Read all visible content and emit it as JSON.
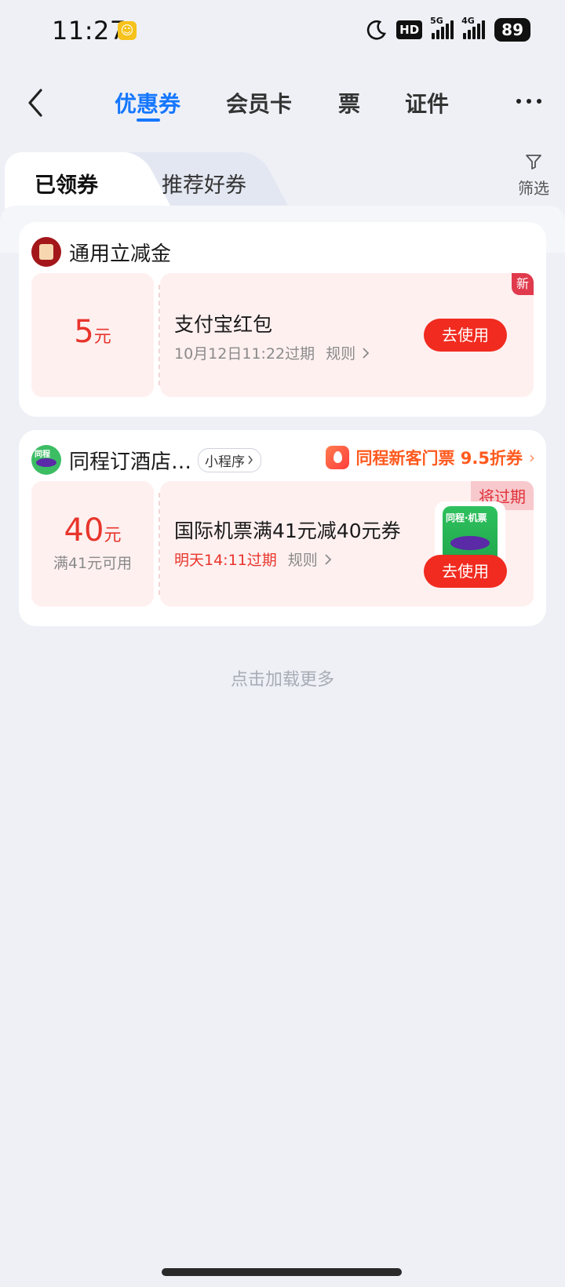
{
  "status_bar": {
    "time": "11:27",
    "hd_label": "HD",
    "network_1": "5G",
    "network_2": "4G",
    "battery": "89"
  },
  "header": {
    "tabs": [
      {
        "label": "优惠券",
        "active": true
      },
      {
        "label": "会员卡",
        "active": false
      },
      {
        "label": "票",
        "active": false
      },
      {
        "label": "证件",
        "active": false
      }
    ],
    "accent_color": "#1677ff"
  },
  "sub_tabs": {
    "active": "已领券",
    "inactive": "推荐好券",
    "filter_label": "筛选"
  },
  "cards": [
    {
      "title": "通用立减金",
      "coupon": {
        "amount": "5",
        "unit": "元",
        "name": "支付宝红包",
        "expire": "10月12日11:22过期",
        "rules": "规则",
        "badge": "新",
        "button": "去使用"
      }
    },
    {
      "title": "同程订酒店…",
      "tag": "小程序",
      "promo": "同程新客门票 9.5折券",
      "coupon": {
        "amount": "40",
        "unit": "元",
        "condition": "满41元可用",
        "name": "国际机票满41元减40元券",
        "expire": "明天14:11过期",
        "rules": "规则",
        "badge": "将过期",
        "thumb_label": "同程·机票",
        "button": "去使用"
      }
    }
  ],
  "load_more": "点击加载更多",
  "colors": {
    "price_red": "#e8352b",
    "button_red": "#f12b1f",
    "coupon_bg": "#fff0f0"
  }
}
